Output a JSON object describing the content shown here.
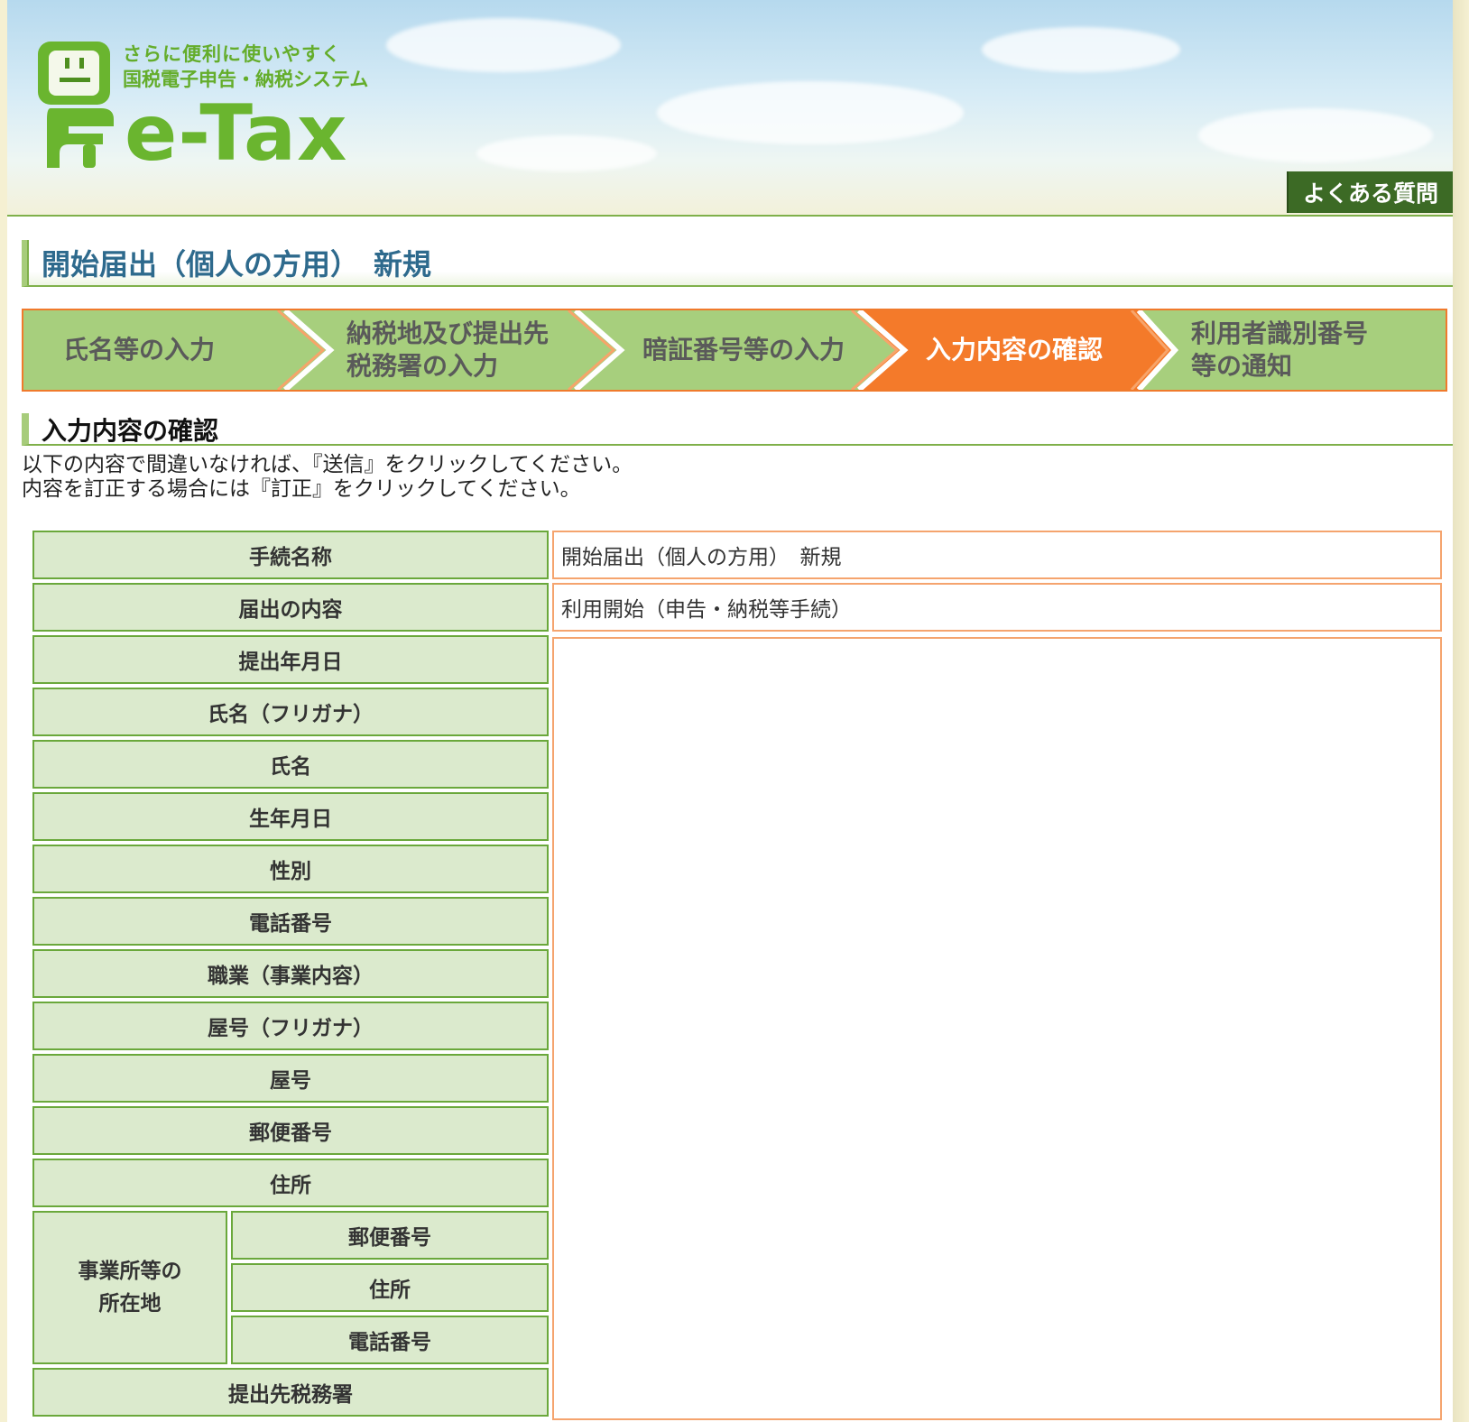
{
  "header": {
    "tagline_line1": "さらに便利に使いやすく",
    "tagline_line2": "国税電子申告・納税システム",
    "logo_word": "e-Tax",
    "faq_button": "よくある質問"
  },
  "page_title": "開始届出（個人の方用）　新規",
  "steps": [
    {
      "line1": "氏名等の入力",
      "line2": "",
      "active": false
    },
    {
      "line1": "納税地及び提出先",
      "line2": "税務署の入力",
      "active": false
    },
    {
      "line1": "暗証番号等の入力",
      "line2": "",
      "active": false
    },
    {
      "line1": "入力内容の確認",
      "line2": "",
      "active": true
    },
    {
      "line1": "利用者識別番号",
      "line2": "等の通知",
      "active": false
    }
  ],
  "section_heading": "入力内容の確認",
  "instructions": {
    "line1": "以下の内容で間違いなければ、『送信』をクリックしてください。",
    "line2": "内容を訂正する場合には『訂正』をクリックしてください。"
  },
  "table": {
    "procedure_name_label": "手続名称",
    "procedure_name_value": "開始届出（個人の方用）　新規",
    "notification_content_label": "届出の内容",
    "notification_content_value": "利用開始（申告・納税等手続）",
    "rows": [
      "提出年月日",
      "氏名（フリガナ）",
      "氏名",
      "生年月日",
      "性別",
      "電話番号",
      "職業（事業内容）",
      "屋号（フリガナ）",
      "屋号",
      "郵便番号",
      "住所"
    ],
    "office_group_label_line1": "事業所等の",
    "office_group_label_line2": "所在地",
    "office_sub_rows": [
      "郵便番号",
      "住所",
      "電話番号"
    ],
    "tax_office_label": "提出先税務署"
  },
  "colors": {
    "accent_green": "#7fb04a",
    "active_step_orange": "#f47a2a",
    "label_bg": "#dbeacd",
    "value_border": "#f5a46e",
    "title_blue": "#2e6a8d"
  }
}
